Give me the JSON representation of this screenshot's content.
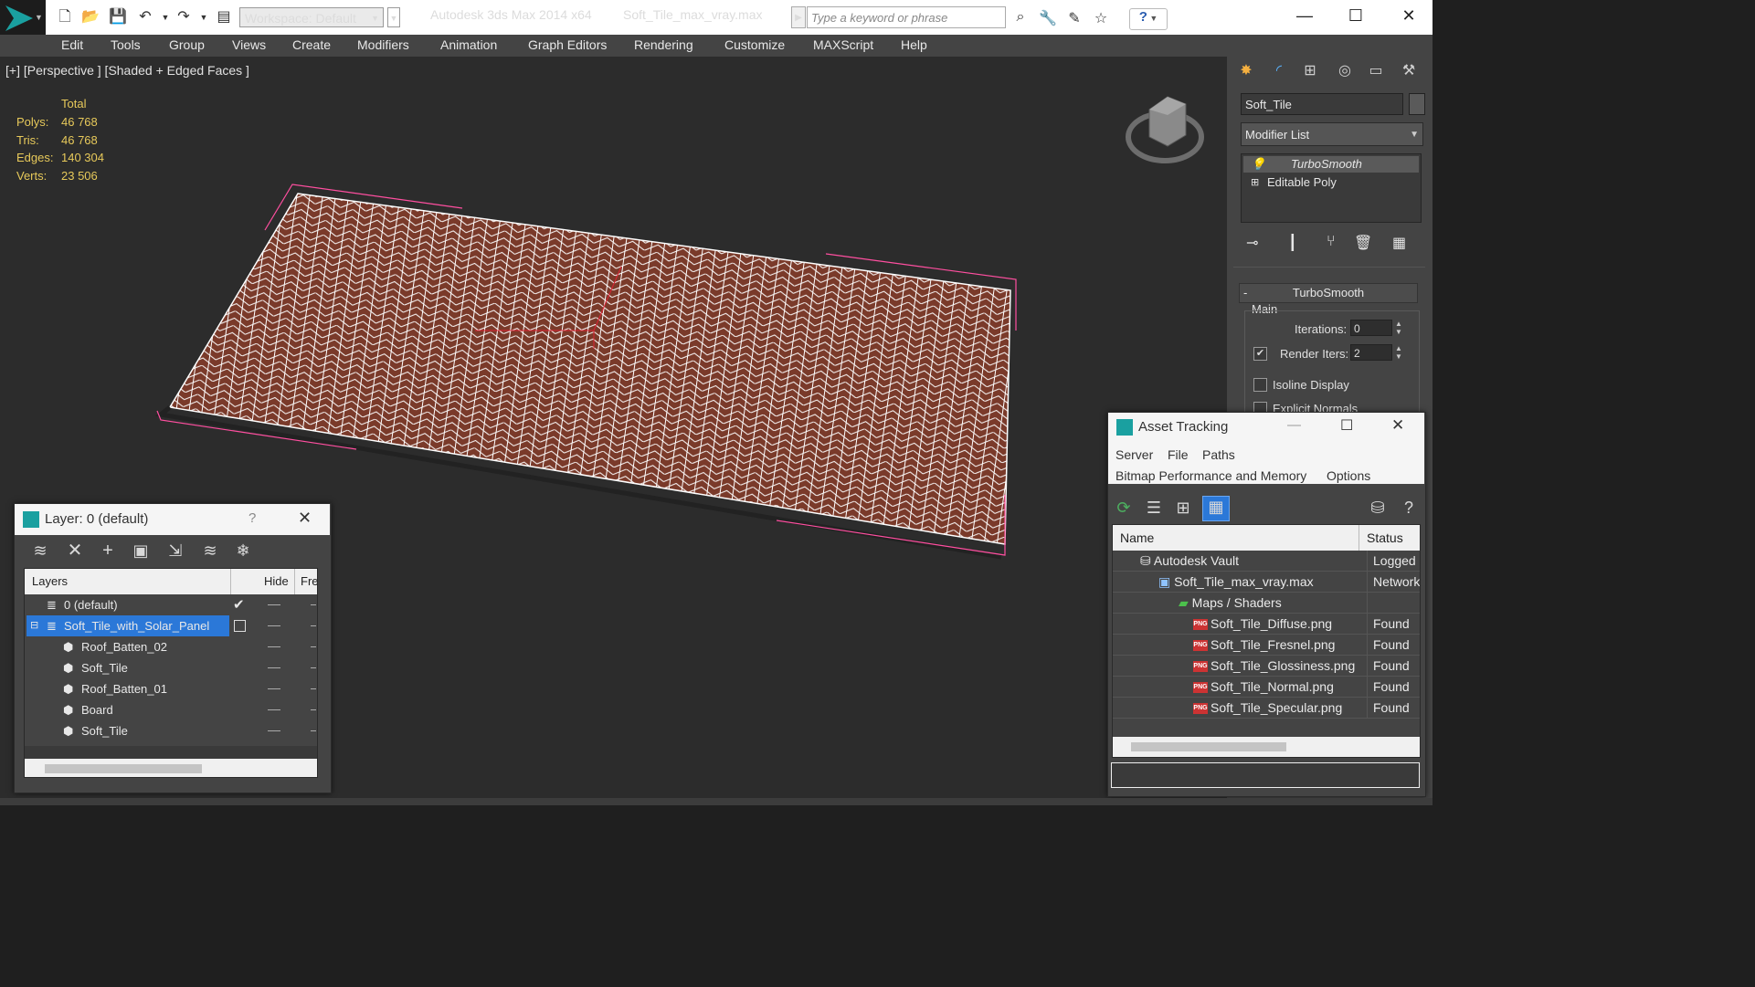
{
  "titlebar": {
    "workspace": "Workspace: Default",
    "app_title": "Autodesk 3ds Max  2014 x64",
    "file_title": "Soft_Tile_max_vray.max",
    "search_placeholder": "Type a keyword or phrase",
    "help_glyph": "?"
  },
  "menu": [
    "Edit",
    "Tools",
    "Group",
    "Views",
    "Create",
    "Modifiers",
    "Animation",
    "Graph Editors",
    "Rendering",
    "Customize",
    "MAXScript",
    "Help"
  ],
  "viewport": {
    "label": "[+] [Perspective ] [Shaded + Edged Faces ]",
    "stats_header": "Total",
    "stats": [
      {
        "label": "Polys:",
        "value": "46 768"
      },
      {
        "label": "Tris:",
        "value": "46 768"
      },
      {
        "label": "Edges:",
        "value": "140 304"
      },
      {
        "label": "Verts:",
        "value": "23 506"
      }
    ],
    "colors": {
      "tile": "#7a3a2a",
      "wire": "#ffffff",
      "selection_box": "#ff4fa0"
    }
  },
  "command_panel": {
    "object_name": "Soft_Tile",
    "modifier_list": "Modifier List",
    "stack": [
      "TurboSmooth",
      "Editable Poly"
    ],
    "rollout_title": "TurboSmooth",
    "rollout_toggle": "-",
    "group_main": "Main",
    "iterations_label": "Iterations:",
    "iterations_value": "0",
    "render_iters_label": "Render Iters:",
    "render_iters_value": "2",
    "render_iters_checked": true,
    "isoline_label": "Isoline Display",
    "explicit_normals_label": "Explicit Normals"
  },
  "layer_dialog": {
    "title": "Layer: 0 (default)",
    "help": "?",
    "columns": [
      "Layers",
      "Hide",
      "Fre"
    ],
    "rows": [
      {
        "name": "0 (default)",
        "type": "layer",
        "indent": 0,
        "selected": false,
        "current": true
      },
      {
        "name": "Soft_Tile_with_Solar_Panel",
        "type": "layer",
        "indent": 0,
        "selected": true,
        "current": false
      },
      {
        "name": "Roof_Batten_02",
        "type": "object",
        "indent": 1,
        "selected": false,
        "current": false
      },
      {
        "name": "Soft_Tile",
        "type": "object",
        "indent": 1,
        "selected": false,
        "current": false
      },
      {
        "name": "Roof_Batten_01",
        "type": "object",
        "indent": 1,
        "selected": false,
        "current": false
      },
      {
        "name": "Board",
        "type": "object",
        "indent": 1,
        "selected": false,
        "current": false
      },
      {
        "name": "Soft_Tile",
        "type": "object",
        "indent": 1,
        "selected": false,
        "current": false
      }
    ]
  },
  "asset_dialog": {
    "title": "Asset Tracking",
    "menu_row1": [
      "Server",
      "File",
      "Paths"
    ],
    "menu_row2": [
      "Bitmap Performance and Memory",
      "Options"
    ],
    "columns": [
      "Name",
      "Status"
    ],
    "rows": [
      {
        "name": "Autodesk Vault",
        "status": "Logged C",
        "indent": 1,
        "icon": "vault"
      },
      {
        "name": "Soft_Tile_max_vray.max",
        "status": "Network",
        "indent": 2,
        "icon": "max"
      },
      {
        "name": "Maps / Shaders",
        "status": "",
        "indent": 3,
        "icon": "folder"
      },
      {
        "name": "Soft_Tile_Diffuse.png",
        "status": "Found",
        "indent": 4,
        "icon": "png"
      },
      {
        "name": "Soft_Tile_Fresnel.png",
        "status": "Found",
        "indent": 4,
        "icon": "png"
      },
      {
        "name": "Soft_Tile_Glossiness.png",
        "status": "Found",
        "indent": 4,
        "icon": "png"
      },
      {
        "name": "Soft_Tile_Normal.png",
        "status": "Found",
        "indent": 4,
        "icon": "png"
      },
      {
        "name": "Soft_Tile_Specular.png",
        "status": "Found",
        "indent": 4,
        "icon": "png"
      }
    ]
  }
}
